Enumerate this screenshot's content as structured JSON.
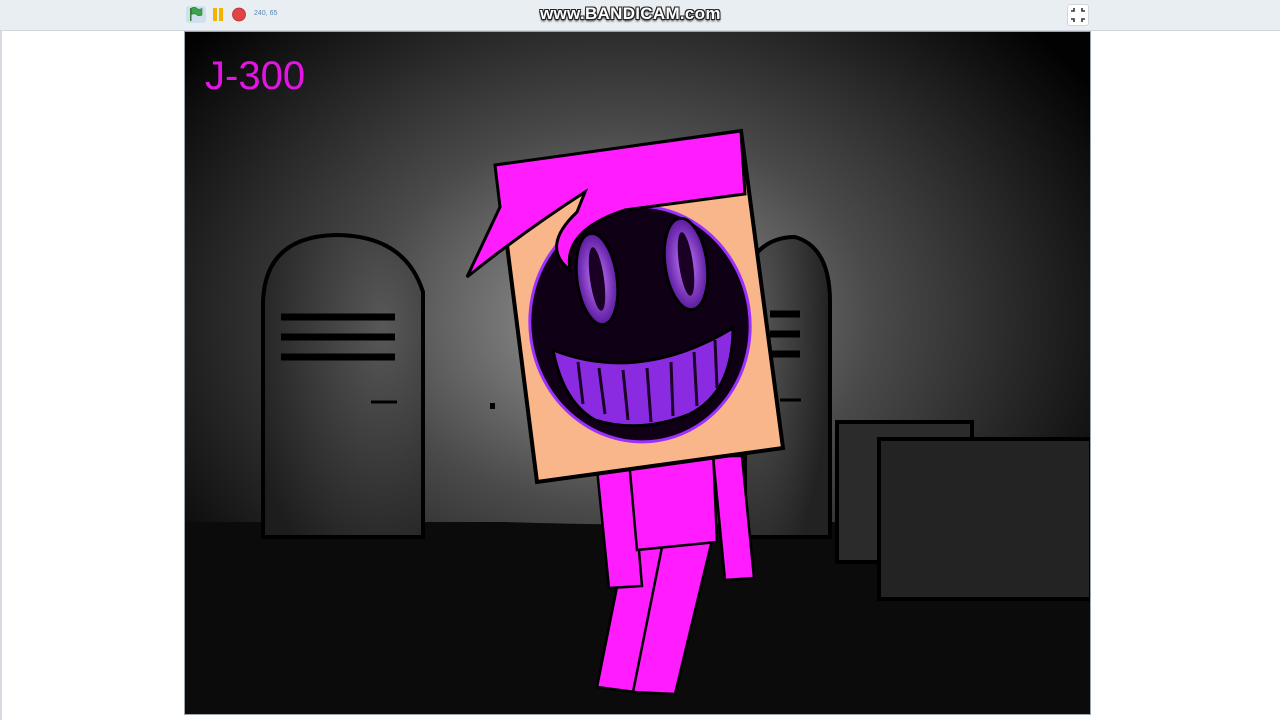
{
  "toolbar": {
    "coords": "240, 65",
    "watermark": "www.BANDICAM.com",
    "icons": [
      "green-flag-icon",
      "pause-icon",
      "stop-icon",
      "fullscreen-exit-icon"
    ],
    "colors": {
      "flag": "#3fa34d",
      "pause": "#f2b400",
      "stop": "#e24343"
    }
  },
  "stage": {
    "score": "J-300",
    "colors": {
      "character": "#ff1cff",
      "face_skin": "#f8b68a",
      "mouth_purple": "#8a2be2"
    }
  }
}
